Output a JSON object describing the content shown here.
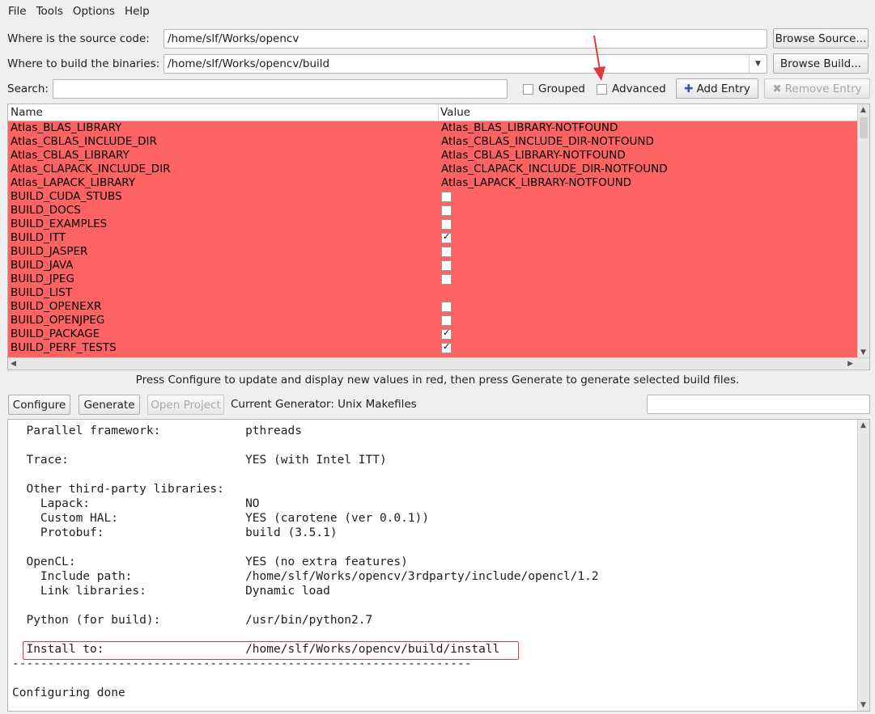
{
  "menu": [
    {
      "label": "File"
    },
    {
      "label": "Tools"
    },
    {
      "label": "Options"
    },
    {
      "label": "Help"
    }
  ],
  "source": {
    "label": "Where is the source code:",
    "value": "/home/slf/Works/opencv",
    "browse": "Browse Source..."
  },
  "build": {
    "label": "Where to build the binaries:",
    "value": "/home/slf/Works/opencv/build",
    "browse": "Browse Build..."
  },
  "search": {
    "label": "Search:",
    "value": "",
    "grouped": "Grouped",
    "advanced": "Advanced",
    "add_entry": "Add Entry",
    "remove_entry": "Remove Entry"
  },
  "table": {
    "columns": [
      "Name",
      "Value"
    ],
    "rows": [
      {
        "name": "Atlas_BLAS_LIBRARY",
        "value": "Atlas_BLAS_LIBRARY-NOTFOUND",
        "type": "text"
      },
      {
        "name": "Atlas_CBLAS_INCLUDE_DIR",
        "value": "Atlas_CBLAS_INCLUDE_DIR-NOTFOUND",
        "type": "text"
      },
      {
        "name": "Atlas_CBLAS_LIBRARY",
        "value": "Atlas_CBLAS_LIBRARY-NOTFOUND",
        "type": "text"
      },
      {
        "name": "Atlas_CLAPACK_INCLUDE_DIR",
        "value": "Atlas_CLAPACK_INCLUDE_DIR-NOTFOUND",
        "type": "text"
      },
      {
        "name": "Atlas_LAPACK_LIBRARY",
        "value": "Atlas_LAPACK_LIBRARY-NOTFOUND",
        "type": "text"
      },
      {
        "name": "BUILD_CUDA_STUBS",
        "value": "",
        "type": "bool",
        "checked": false
      },
      {
        "name": "BUILD_DOCS",
        "value": "",
        "type": "bool",
        "checked": false
      },
      {
        "name": "BUILD_EXAMPLES",
        "value": "",
        "type": "bool",
        "checked": false
      },
      {
        "name": "BUILD_ITT",
        "value": "",
        "type": "bool",
        "checked": true
      },
      {
        "name": "BUILD_JASPER",
        "value": "",
        "type": "bool",
        "checked": false
      },
      {
        "name": "BUILD_JAVA",
        "value": "",
        "type": "bool",
        "checked": false
      },
      {
        "name": "BUILD_JPEG",
        "value": "",
        "type": "bool",
        "checked": false
      },
      {
        "name": "BUILD_LIST",
        "value": "",
        "type": "text"
      },
      {
        "name": "BUILD_OPENEXR",
        "value": "",
        "type": "bool",
        "checked": false
      },
      {
        "name": "BUILD_OPENJPEG",
        "value": "",
        "type": "bool",
        "checked": false
      },
      {
        "name": "BUILD_PACKAGE",
        "value": "",
        "type": "bool",
        "checked": true
      },
      {
        "name": "BUILD_PERF_TESTS",
        "value": "",
        "type": "bool",
        "checked": true
      }
    ]
  },
  "hint": "Press Configure to update and display new values in red, then press Generate to generate selected build files.",
  "actions": {
    "configure": "Configure",
    "generate": "Generate",
    "open_project": "Open Project",
    "generator": "Current Generator: Unix Makefiles"
  },
  "log": [
    "  Parallel framework:            pthreads",
    "",
    "  Trace:                         YES (with Intel ITT)",
    "",
    "  Other third-party libraries:",
    "    Lapack:                      NO",
    "    Custom HAL:                  YES (carotene (ver 0.0.1))",
    "    Protobuf:                    build (3.5.1)",
    "",
    "  OpenCL:                        YES (no extra features)",
    "    Include path:                /home/slf/Works/opencv/3rdparty/include/opencl/1.2",
    "    Link libraries:              Dynamic load",
    "",
    "  Python (for build):            /usr/bin/python2.7",
    "",
    "  Install to:                    /home/slf/Works/opencv/build/install",
    "-----------------------------------------------------------------",
    "",
    "Configuring done"
  ],
  "colors": {
    "error_row": "#fe6363",
    "highlight": "#e0383c"
  }
}
